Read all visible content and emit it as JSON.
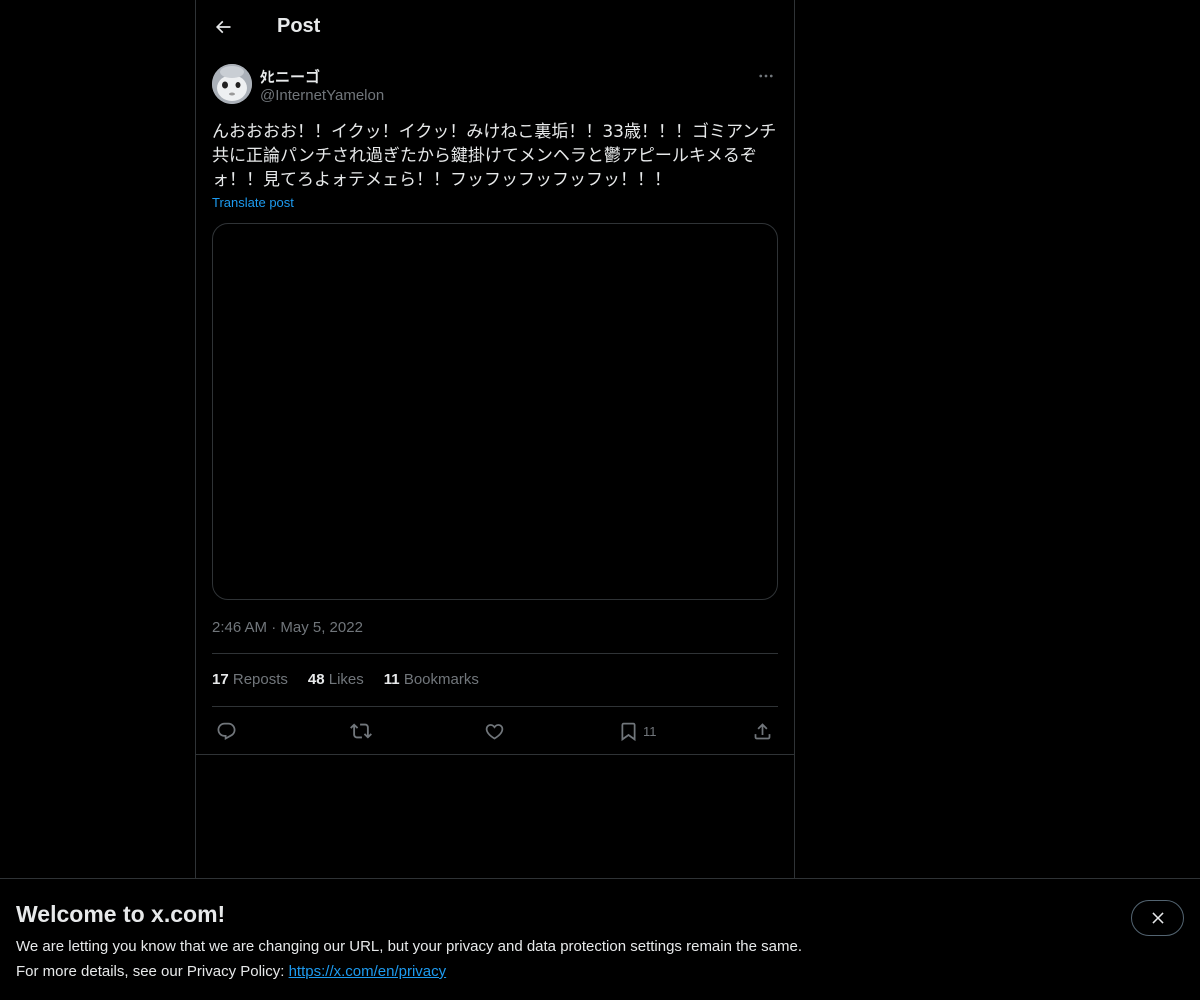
{
  "header": {
    "title": "Post",
    "back_icon": "arrow-left-icon"
  },
  "post": {
    "display_name": "ﾀﾋニーゴ",
    "handle": "@InternetYamelon",
    "more_icon": "ellipsis-icon",
    "text": "んおおおお！！イクッ！イクッ！みけねこ裏垢！！33歳！！！ゴミアンチ共に正論パンチされ過ぎたから鍵掛けてメンヘラと鬱アピールキメるぞォ！！見てろよォテメェら！！フッフッフッフッフッ！！！",
    "translate_label": "Translate post",
    "timestamp": "2:46 AM · May 5, 2022"
  },
  "stats": {
    "reposts_count": "17",
    "reposts_label": "Reposts",
    "likes_count": "48",
    "likes_label": "Likes",
    "bookmarks_count": "11",
    "bookmarks_label": "Bookmarks"
  },
  "actions": {
    "reply_icon": "reply-icon",
    "repost_icon": "repost-icon",
    "like_icon": "heart-icon",
    "bookmark_icon": "bookmark-icon",
    "bookmark_count": "11",
    "share_icon": "share-icon"
  },
  "banner": {
    "title": "Welcome to x.com!",
    "line1": "We are letting you know that we are changing our URL, but your privacy and data protection settings remain the same.",
    "line2_prefix": "For more details, see our Privacy Policy: ",
    "link_text": "https://x.com/en/privacy",
    "close_icon": "close-icon"
  },
  "colors": {
    "background": "#000000",
    "text_primary": "#e7e9ea",
    "text_secondary": "#71767b",
    "accent": "#1d9bf0",
    "border": "#2f3336"
  }
}
